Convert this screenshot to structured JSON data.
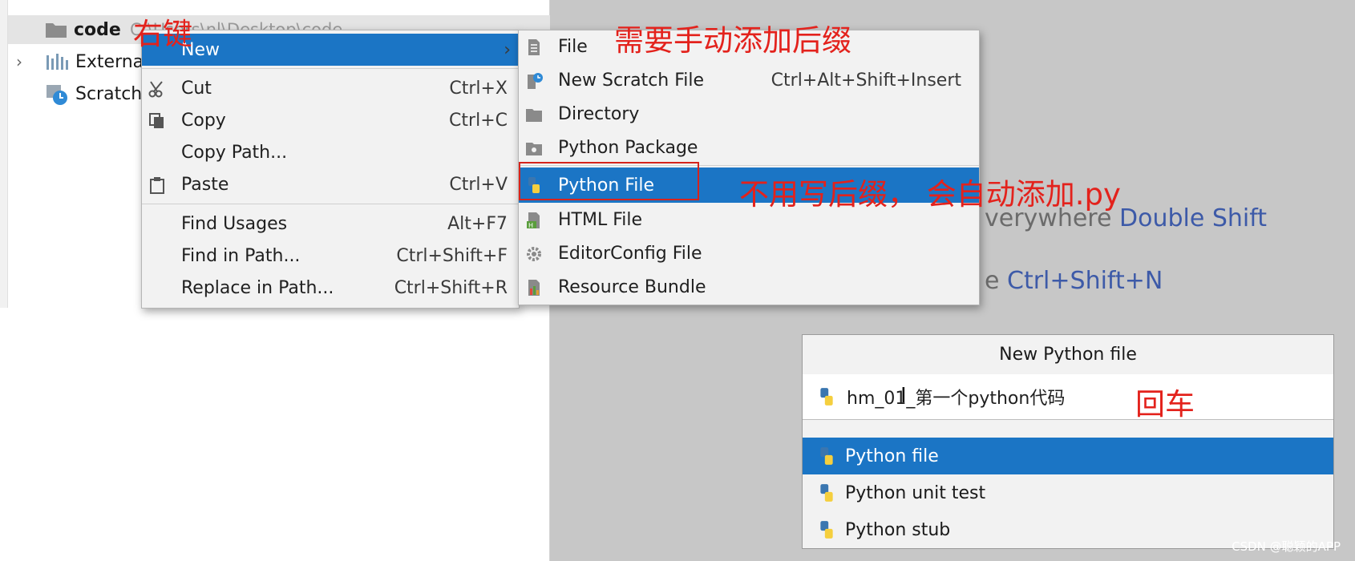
{
  "project_tree": {
    "root": {
      "name": "code",
      "path": "C:\\Users\\nl\\Desktop\\code"
    },
    "external": "Externa",
    "scratches": "Scratch"
  },
  "editor_hints": {
    "search_partial": "verywhere",
    "search_key": "Double Shift",
    "goto_partial": "e",
    "goto_key": "Ctrl+Shift+N"
  },
  "context_menu": {
    "new_label": "New",
    "items": [
      {
        "label": "Cut",
        "shortcut": "Ctrl+X",
        "icon": "scissors-icon"
      },
      {
        "label": "Copy",
        "shortcut": "Ctrl+C",
        "icon": "copy-icon"
      },
      {
        "label": "Copy Path...",
        "shortcut": ""
      },
      {
        "label": "Paste",
        "shortcut": "Ctrl+V",
        "icon": "clipboard-icon"
      },
      {
        "label": "Find Usages",
        "shortcut": "Alt+F7"
      },
      {
        "label": "Find in Path...",
        "shortcut": "Ctrl+Shift+F"
      },
      {
        "label": "Replace in Path...",
        "shortcut": "Ctrl+Shift+R"
      }
    ]
  },
  "new_submenu": {
    "items": [
      {
        "label": "File",
        "shortcut": "",
        "icon": "file-icon"
      },
      {
        "label": "New Scratch File",
        "shortcut": "Ctrl+Alt+Shift+Insert",
        "icon": "scratch-file-icon"
      },
      {
        "label": "Directory",
        "shortcut": "",
        "icon": "folder-icon"
      },
      {
        "label": "Python Package",
        "shortcut": "",
        "icon": "package-icon"
      },
      {
        "label": "Python File",
        "shortcut": "",
        "icon": "python-icon"
      },
      {
        "label": "HTML File",
        "shortcut": "",
        "icon": "html-file-icon"
      },
      {
        "label": "EditorConfig File",
        "shortcut": "",
        "icon": "gear-icon"
      },
      {
        "label": "Resource Bundle",
        "shortcut": "",
        "icon": "bundle-icon"
      }
    ]
  },
  "new_python_dialog": {
    "title": "New Python file",
    "filename": "hm_01_第一个python代码",
    "options": [
      "Python file",
      "Python unit test",
      "Python stub"
    ]
  },
  "annotations": {
    "right_click": "右键",
    "manual_suffix": "需要手动添加后缀",
    "auto_suffix": "不用写后缀， 会自动添加.py",
    "enter": "回车"
  },
  "watermark": "CSDN @聪颖的APP",
  "colors": {
    "selection": "#1b75c5",
    "annotation": "#e3221c",
    "shortcut_key": "#3d5aa8"
  }
}
